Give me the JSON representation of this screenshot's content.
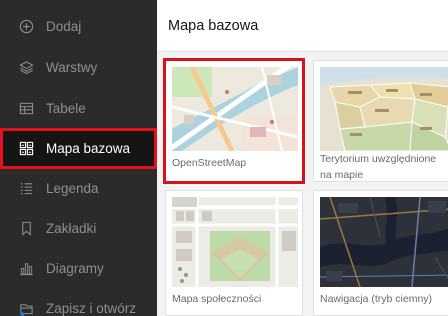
{
  "sidebar": {
    "items": [
      {
        "label": "Dodaj",
        "icon": "plus-circle-icon"
      },
      {
        "label": "Warstwy",
        "icon": "layers-icon"
      },
      {
        "label": "Tabele",
        "icon": "table-icon"
      },
      {
        "label": "Mapa bazowa",
        "icon": "basemap-grid-icon"
      },
      {
        "label": "Legenda",
        "icon": "legend-icon"
      },
      {
        "label": "Zakładki",
        "icon": "bookmark-icon"
      },
      {
        "label": "Diagramy",
        "icon": "chart-icon"
      },
      {
        "label": "Zapisz i otwórz",
        "icon": "save-open-icon"
      }
    ]
  },
  "panel": {
    "title": "Mapa bazowa",
    "basemaps": [
      {
        "label": "OpenStreetMap",
        "selected": true
      },
      {
        "label": "Terytorium uwzględnione na mapie",
        "selected": false
      },
      {
        "label": "Mapa społeczności",
        "selected": false
      },
      {
        "label": "Nawigacja (tryb ciemny)",
        "selected": false
      }
    ]
  },
  "colors": {
    "sidebar_bg": "#2b2b2b",
    "active_bg": "#151515",
    "highlight": "#e8101b"
  }
}
